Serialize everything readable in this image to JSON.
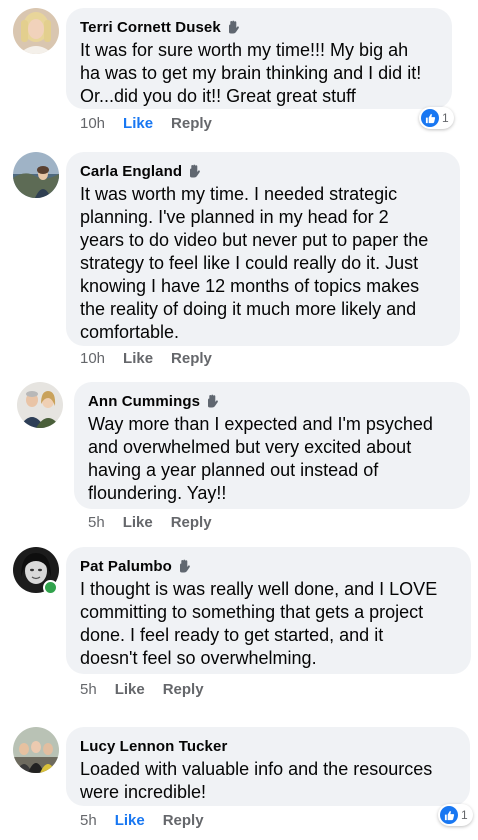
{
  "colors": {
    "bubble": "#f0f2f5",
    "link_blue": "#1877f2",
    "meta_gray": "#65676b",
    "online_green": "#31a24c"
  },
  "icons": {
    "author_badge": "waving-hand-icon",
    "reaction": "thumbs-up-icon"
  },
  "comments": [
    {
      "author": "Terri Cornett Dusek",
      "text": "It was for sure worth my time!!! My big ah\nha was to get my brain thinking and I did it!\nOr...did you do it!!  Great great stuff",
      "time": "10h",
      "like_label": "Like",
      "reply_label": "Reply",
      "liked": true,
      "reaction_count": "1"
    },
    {
      "author": "Carla England",
      "text": "It was worth my time. I needed strategic\nplanning. I've planned in my head for 2\nyears to do video but never put to paper the\nstrategy to feel like I could really do it. Just\nknowing I have 12 months of topics makes\nthe reality of doing it much more likely and\ncomfortable.",
      "time": "10h",
      "like_label": "Like",
      "reply_label": "Reply",
      "liked": false
    },
    {
      "author": "Ann Cummings",
      "text": "Way more than I expected and I'm psyched\nand overwhelmed but very excited about\nhaving a year planned out instead of\nfloundering.  Yay!!",
      "time": "5h",
      "like_label": "Like",
      "reply_label": "Reply",
      "liked": false
    },
    {
      "author": "Pat Palumbo",
      "text": "I thought is was really well done, and I LOVE\ncommitting to something that gets a project\ndone. I feel ready to get started, and it\ndoesn't feel so overwhelming.",
      "time": "5h",
      "like_label": "Like",
      "reply_label": "Reply",
      "liked": false,
      "online": true
    },
    {
      "author": "Lucy Lennon Tucker",
      "text": "Loaded with valuable info and the resources\nwere incredible!",
      "time": "5h",
      "like_label": "Like",
      "reply_label": "Reply",
      "liked": true,
      "reaction_count": "1"
    }
  ]
}
